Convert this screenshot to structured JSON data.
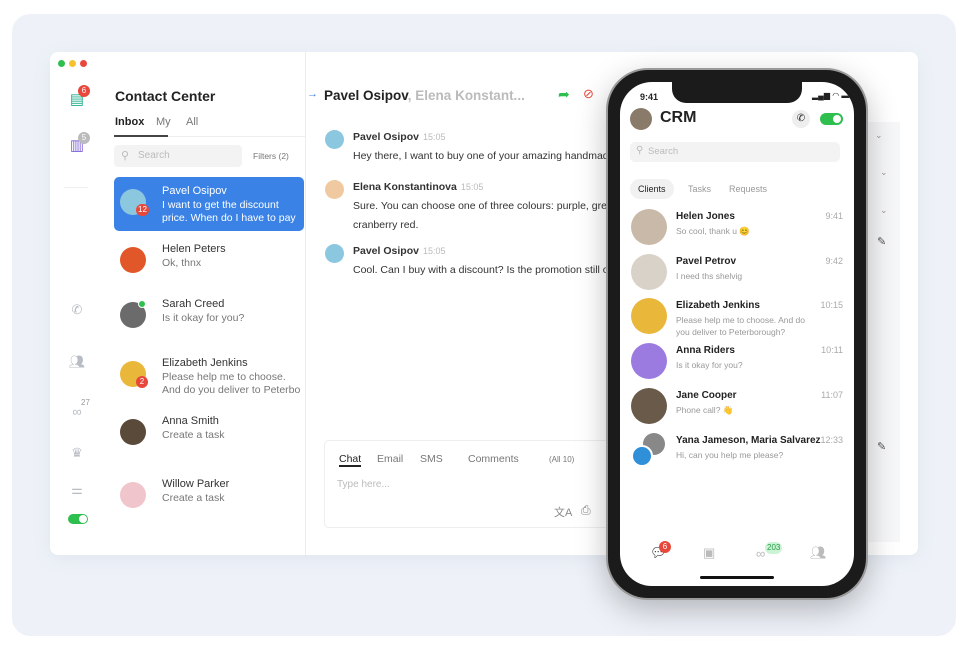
{
  "window": {
    "title": "Contact Center",
    "colors": {
      "accent": "#3b82e6",
      "green": "#2fbf4f",
      "red": "#e8483b"
    }
  },
  "sidebar": {
    "chat_badge": "6",
    "mail_badge": "5",
    "handshake_count": "27",
    "icons": [
      "chat-icon",
      "messages-icon",
      "phone-icon",
      "people-icon",
      "handshake-icon",
      "crown-icon",
      "sliders-icon",
      "toggle"
    ]
  },
  "list": {
    "tabs": [
      "Inbox",
      "My",
      "All"
    ],
    "search_placeholder": "Search",
    "filters": "Filters (2)",
    "items": [
      {
        "name": "Pavel Osipov",
        "preview": "I want to get the discount",
        "preview2": "price. When do I have to pay",
        "badge": "12",
        "color": "#8cc7e0"
      },
      {
        "name": "Helen Peters",
        "preview": "Ok, thnx",
        "color": "#e2572a"
      },
      {
        "name": "Sarah Creed",
        "preview": "Is it okay for you?",
        "color": "#6b6b6b"
      },
      {
        "name": "Elizabeth Jenkins",
        "preview": "Please help me to choose.",
        "preview2": "And do you deliver to Peterbo",
        "badge": "2",
        "color": "#e9b83a"
      },
      {
        "name": "Anna Smith",
        "preview": "Create a task",
        "color": "#5a4a3a"
      },
      {
        "name": "Willow Parker",
        "preview": "Create a task",
        "color": "#f0c6cc"
      }
    ]
  },
  "chat": {
    "title": "Pavel Osipov",
    "title_rest": ", Elena Konstant...",
    "messages": [
      {
        "name": "Pavel Osipov",
        "time": "15:05",
        "text": "Hey there, I want to buy one of your amazing handmade"
      },
      {
        "name": "Elena Konstantinova",
        "time": "15:05",
        "text": "Sure. You can choose one of three colours: purple, green or",
        "text2": "cranberry red."
      },
      {
        "name": "Pavel Osipov",
        "time": "15:05",
        "text": "Cool. Can I buy with a discount? Is the promotion still on?"
      }
    ],
    "composer": {
      "tabs": [
        "Chat",
        "Email",
        "SMS",
        "Comments"
      ],
      "all": "(All 10)",
      "placeholder": "Type here..."
    }
  },
  "phone": {
    "time": "9:41",
    "title": "CRM",
    "search_placeholder": "Search",
    "tabs": [
      "Clients",
      "Tasks",
      "Requests"
    ],
    "items": [
      {
        "name": "Helen Jones",
        "time": "9:41",
        "preview": "So cool, thank u 😊",
        "color": "#c9b9a8"
      },
      {
        "name": "Pavel Petrov",
        "time": "9:42",
        "preview": "I need ths shelvig",
        "color": "#d8d2c8"
      },
      {
        "name": "Elizabeth Jenkins",
        "time": "10:15",
        "preview": "Please help me to choose. And do you deliver to Peterborough?",
        "color": "#e9b83a"
      },
      {
        "name": "Anna Riders",
        "time": "10:11",
        "preview": "Is it okay for you?",
        "color": "#9b7be0"
      },
      {
        "name": "Jane Cooper",
        "time": "11:07",
        "preview": "Phone call? 👋",
        "color": "#6a5a4a"
      },
      {
        "name": "Yana Jameson, Maria Salvarez",
        "time": "12:33",
        "preview": "Hi, can you help me please?",
        "color": "#2f8fd8"
      }
    ],
    "nav": {
      "chat_badge": "6",
      "deals_badge": "203"
    }
  }
}
